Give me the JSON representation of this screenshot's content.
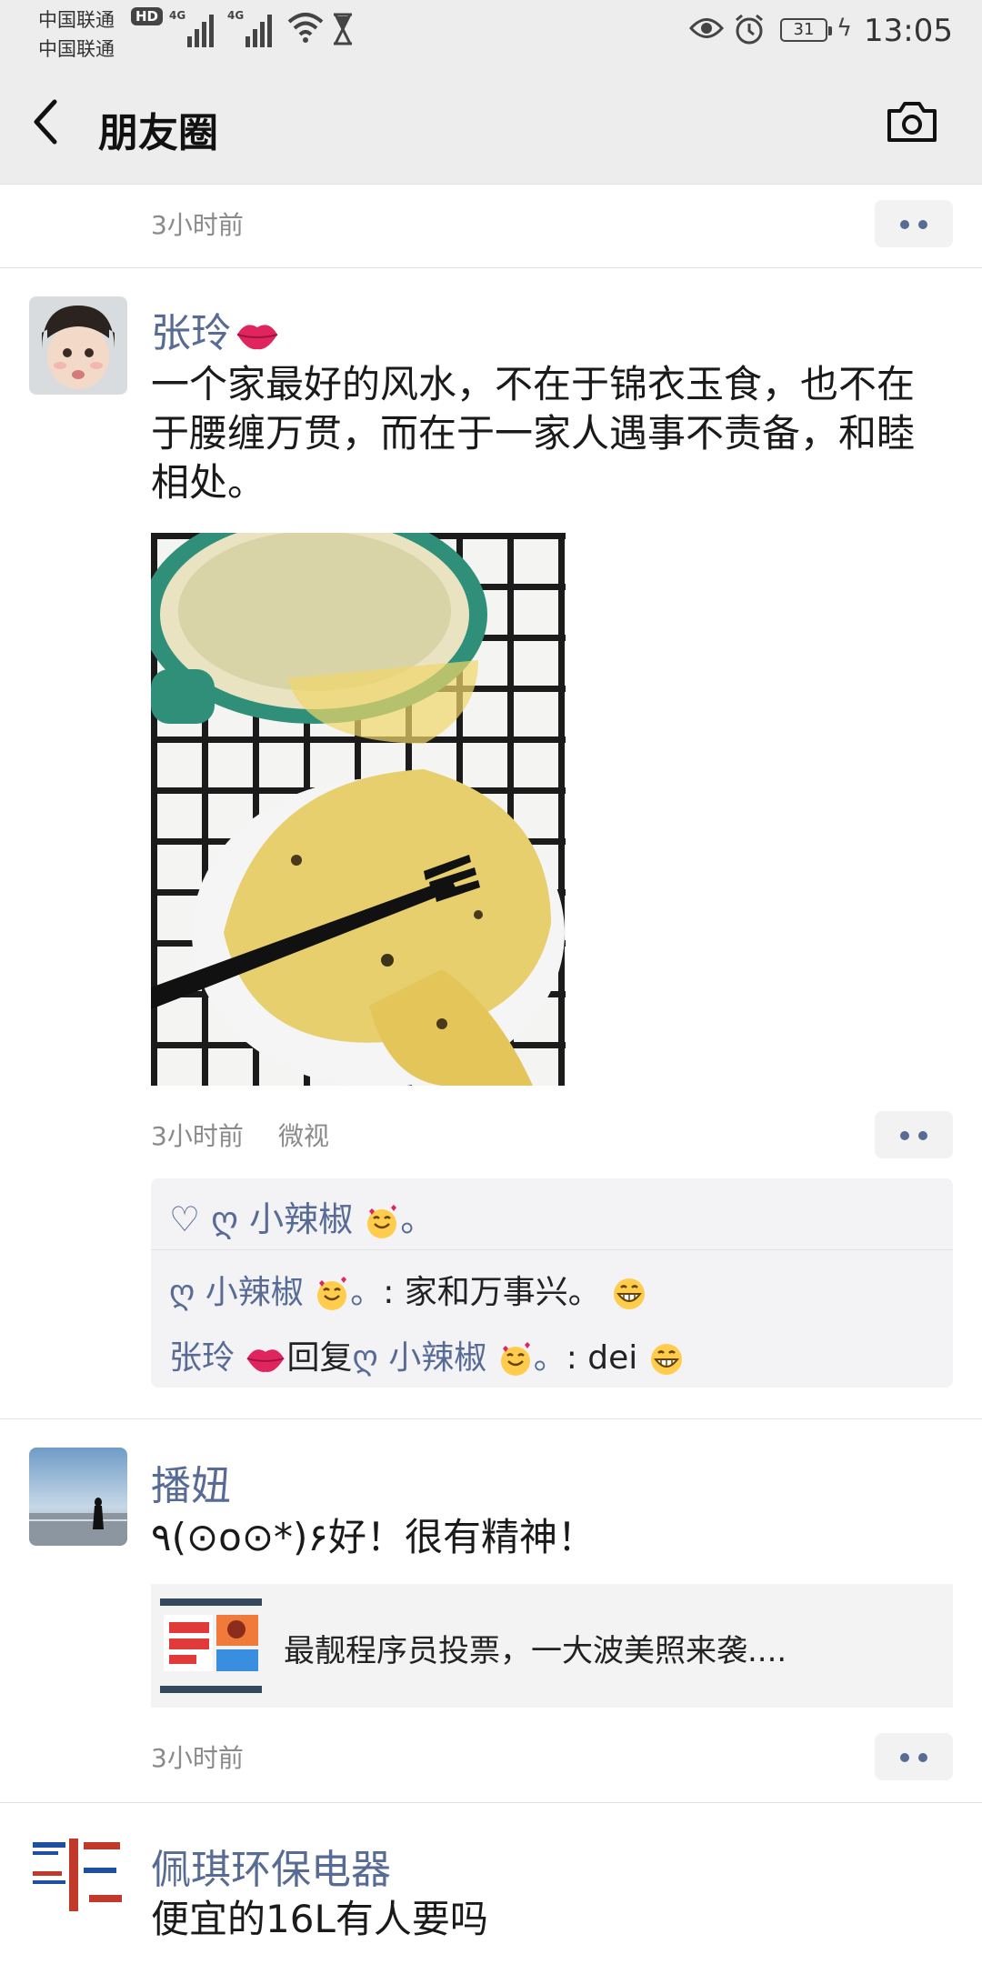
{
  "status_bar": {
    "carrier_1": "中国联通",
    "carrier_2": "中国联通",
    "hd_badge": "HD",
    "net_1": "4G",
    "net_2": "4G",
    "battery": "31",
    "time": "13:05"
  },
  "nav": {
    "title": "朋友圈",
    "back_icon": "back-arrow-icon",
    "camera_icon": "camera-icon"
  },
  "posts": [
    {
      "time": "3小时前"
    },
    {
      "author": "张玲",
      "text": "一个家最好的风水，不在于锦衣玉食，也不在于腰缠万贯，而在于一家人遇事不责备，和睦相处。",
      "time": "3小时前",
      "source": "微视",
      "likes": {
        "heart_icon": "heart-icon",
        "names": "ღ 小辣椒"
      },
      "comments": [
        {
          "author": "ღ 小辣椒",
          "reply_to": "",
          "text": ": 家和万事兴。"
        },
        {
          "author": "张玲",
          "reply_word": "回复",
          "reply_to": "ღ 小辣椒",
          "text": ": dei"
        }
      ]
    },
    {
      "author": "播妞",
      "text": "٩(⊙o⊙*)۶好！很有精神！",
      "link_title": "最靓程序员投票，一大波美照来袭....",
      "time": "3小时前"
    },
    {
      "author": "佩琪环保电器",
      "text": "便宜的16L有人要吗"
    }
  ],
  "colors": {
    "nickname": "#576b95",
    "header_bg": "#ededed",
    "comment_bg": "#f3f3f5"
  }
}
